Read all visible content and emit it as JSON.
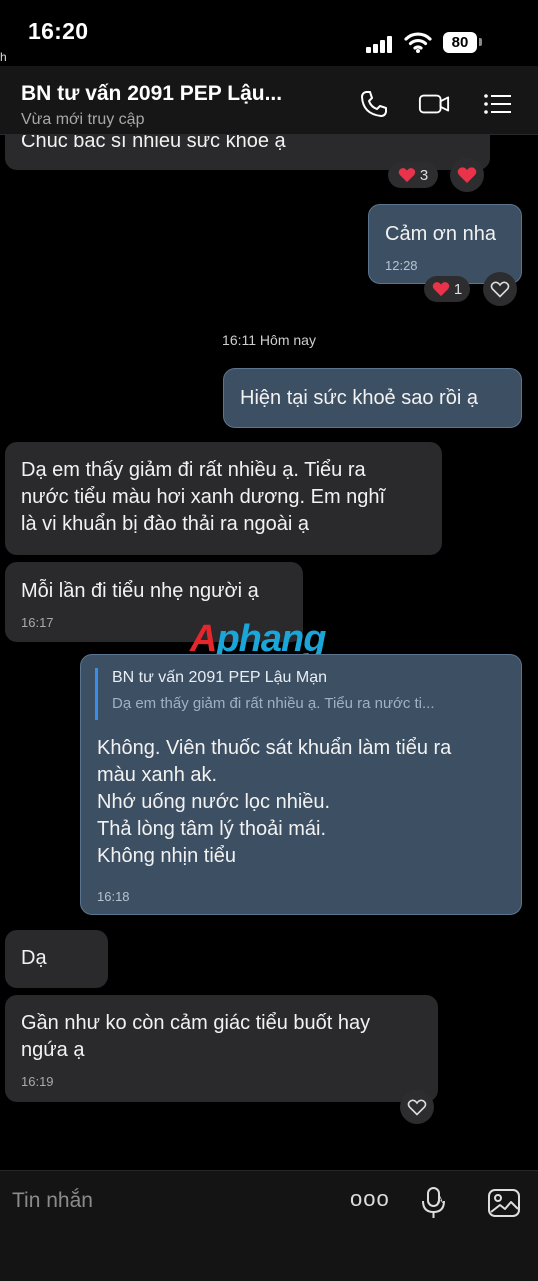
{
  "status_bar": {
    "time": "16:20",
    "edge_letter": "h",
    "battery": "80"
  },
  "header": {
    "title": "BN tư vấn 2091 PEP Lậu...",
    "subtitle": "Vừa mới truy cập",
    "icons": [
      "phone-icon",
      "video-icon",
      "menu-icon"
    ]
  },
  "messages": {
    "m0": {
      "text": "Chúc bác sĩ nhiều sức khỏe ạ",
      "reaction_count": "3"
    },
    "m1": {
      "text": "Cảm ơn nha",
      "time": "12:28",
      "reaction_count": "1"
    },
    "date_separator": "16:11 Hôm nay",
    "m2": {
      "text": "Hiện tại sức khoẻ sao rồi ạ"
    },
    "m3": {
      "text": "Dạ em thấy giảm đi rất nhiều ạ. Tiểu ra\nnước tiểu màu hơi xanh dương. Em nghĩ\nlà vi khuẩn bị đào thải ra ngoài ạ"
    },
    "m4": {
      "text": "Mỗi lần đi tiểu nhẹ người ạ",
      "time": "16:17"
    },
    "m5": {
      "quote_name": "BN tư vấn 2091 PEP Lậu Mạn",
      "quote_text": "Dạ em thấy giảm đi rất nhiều ạ. Tiểu ra nước ti...",
      "text": "Không. Viên thuốc sát khuẩn làm tiểu ra\nmàu xanh ak.\nNhớ uống nước lọc nhiều.\nThả lòng tâm lý thoải mái.\nKhông nhịn tiểu",
      "time": "16:18"
    },
    "m6": {
      "text": "Dạ"
    },
    "m7": {
      "text": "Gần như ko còn cảm giác tiểu buốt hay\nngứa ạ",
      "time": "16:19"
    }
  },
  "watermark": {
    "part1": "A",
    "part2": "phang"
  },
  "composer": {
    "placeholder": "Tin nhắn",
    "more": "ooo"
  },
  "colors": {
    "incoming": "#2a2a2c",
    "outgoing": "#3d4f62",
    "accent": "#3a8ee8",
    "heart": "#e8334a"
  }
}
